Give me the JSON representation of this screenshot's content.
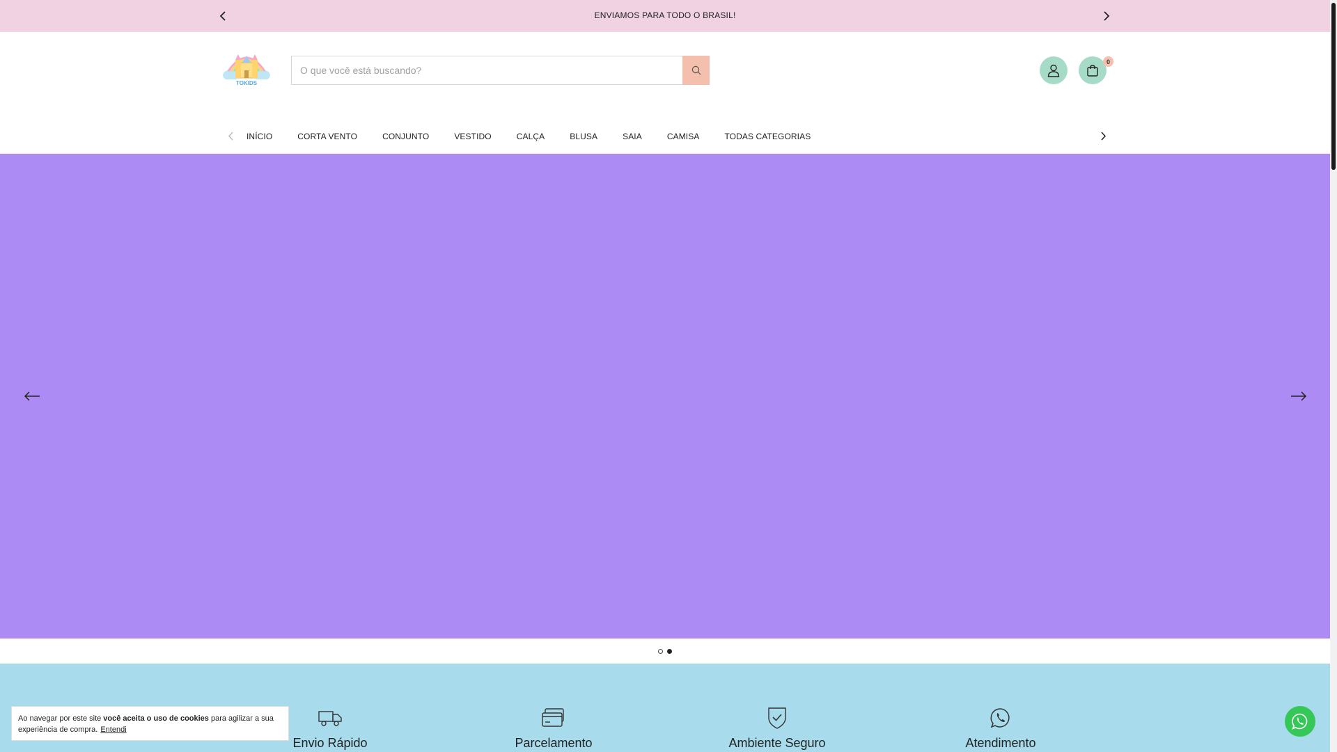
{
  "announcement": {
    "text": "ENVIAMOS PARA TODO O BRASIL!"
  },
  "header": {
    "logo_alt": "TOKIDS",
    "search": {
      "placeholder": "O que você está buscando?",
      "value": ""
    },
    "cart_count": "0"
  },
  "nav": {
    "items": [
      "INÍCIO",
      "CORTA VENTO",
      "CONJUNTO",
      "VESTIDO",
      "CALÇA",
      "BLUSA",
      "SAIA",
      "CAMISA",
      "TODAS CATEGORIAS"
    ]
  },
  "hero": {
    "background": "#ad8bf4",
    "active_slide": 2,
    "slide_count": 2
  },
  "features": [
    {
      "icon": "truck-icon",
      "title": "Envio Rápido"
    },
    {
      "icon": "cards-icon",
      "title": "Parcelamento"
    },
    {
      "icon": "shield-check-icon",
      "title": "Ambiente Seguro"
    },
    {
      "icon": "whatsapp-icon",
      "title": "Atendimento"
    }
  ],
  "cookie": {
    "text_start": "Ao navegar por este site ",
    "text_bold": "você aceita o uso de cookies",
    "text_end": " para agilizar a sua experiência de compra.",
    "link": "Entendi"
  },
  "colors": {
    "announcement_bg": "#f0d2e3",
    "accent_button": "#f5bfae",
    "icon_buttons": "#a6dcc7",
    "features_bg": "#a8dbeb",
    "whatsapp": "#35c758"
  }
}
